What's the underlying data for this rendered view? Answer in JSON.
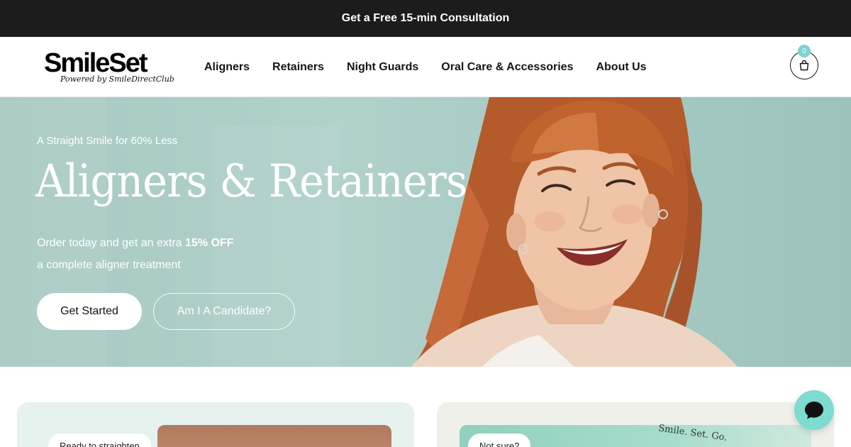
{
  "announcement": {
    "text": "Get a Free 15-min Consultation"
  },
  "brand": {
    "name": "SmileSet",
    "tagline": "Powered by SmileDirectClub"
  },
  "nav": {
    "items": [
      {
        "label": "Aligners"
      },
      {
        "label": "Retainers"
      },
      {
        "label": "Night Guards"
      },
      {
        "label": "Oral Care & Accessories"
      },
      {
        "label": "About Us"
      }
    ],
    "cart_count": "0",
    "cart_icon": "shopping-bag-icon"
  },
  "hero": {
    "eyebrow": "A Straight Smile for 60% Less",
    "title": "Aligners & Retainers",
    "offer_prefix": "Order today and get an extra ",
    "offer_highlight": "15% OFF",
    "offer_line2": "a complete aligner treatment",
    "primary_cta": "Get Started",
    "secondary_cta": "Am I A Candidate?"
  },
  "cards": [
    {
      "pill": "Ready to straighten"
    },
    {
      "pill": "Not sure?",
      "package_text": "Smile. Set. Go."
    }
  ],
  "chat": {
    "icon": "chat-bubble-icon"
  },
  "colors": {
    "announcement_bg": "#1c1c1c",
    "hero_bg": "#aacbc5",
    "accent": "#7dd3cf",
    "chat_bg": "#7ddccf"
  }
}
